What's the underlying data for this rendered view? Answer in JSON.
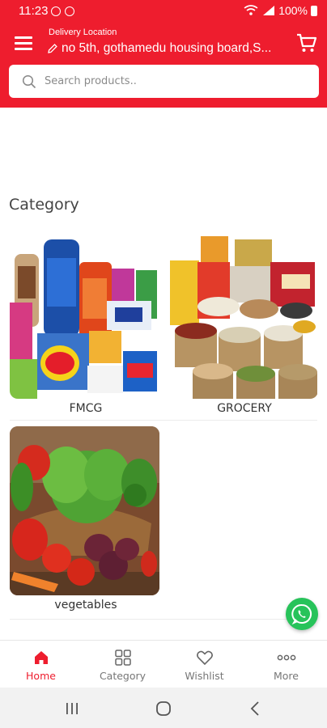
{
  "status_bar": {
    "time": "11:23",
    "battery": "100%"
  },
  "header": {
    "location_label": "Delivery Location",
    "location_address": "no 5th, gothamedu housing board,S..."
  },
  "search": {
    "placeholder": "Search products.."
  },
  "category_section": {
    "title": "Category",
    "items": [
      {
        "label": "FMCG"
      },
      {
        "label": "GROCERY"
      },
      {
        "label": "vegetables"
      }
    ]
  },
  "bottom_nav": {
    "items": [
      {
        "label": "Home",
        "icon": "home-icon",
        "active": true
      },
      {
        "label": "Category",
        "icon": "grid-icon",
        "active": false
      },
      {
        "label": "Wishlist",
        "icon": "heart-icon",
        "active": false
      },
      {
        "label": "More",
        "icon": "more-dots-icon",
        "active": false
      }
    ]
  },
  "colors": {
    "brand": "#ee1d2e",
    "whatsapp": "#27c35a"
  }
}
